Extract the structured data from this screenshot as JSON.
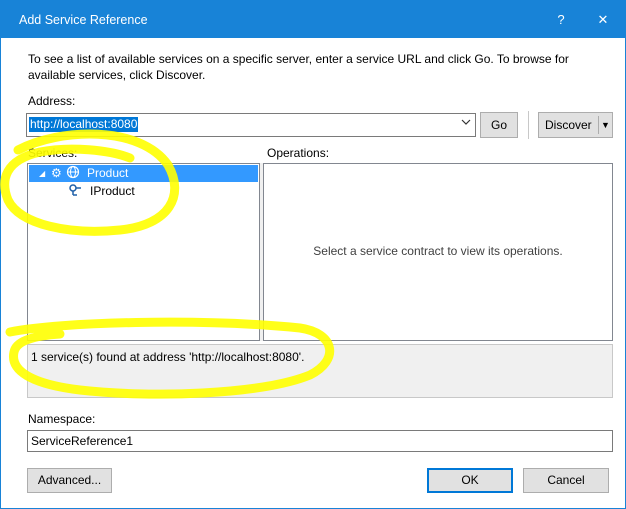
{
  "window": {
    "title": "Add Service Reference",
    "help_label": "?",
    "close_label": "✕"
  },
  "intro_text": "To see a list of available services on a specific server, enter a service URL and click Go. To browse for available services, click Discover.",
  "address": {
    "label": "Address:",
    "value": "http://localhost:8080",
    "dropdown_icon": "chevron-down-icon"
  },
  "buttons": {
    "go": "Go",
    "discover": "Discover",
    "advanced": "Advanced...",
    "ok": "OK",
    "cancel": "Cancel"
  },
  "services": {
    "label": "Services:",
    "items": [
      {
        "label": "Product",
        "expanded": true,
        "selected": true,
        "icons": [
          "gear-icon",
          "globe-icon"
        ]
      },
      {
        "label": "IProduct",
        "icons": [
          "interface-icon"
        ]
      }
    ]
  },
  "operations": {
    "label": "Operations:",
    "empty_message": "Select a service contract to view its operations."
  },
  "status_text": "1 service(s) found at address 'http://localhost:8080'.",
  "namespace": {
    "label": "Namespace:",
    "value": "ServiceReference1"
  },
  "colors": {
    "titlebar": "#1883d7",
    "selection": "#3399ff",
    "highlight_marker": "#ffff00"
  }
}
